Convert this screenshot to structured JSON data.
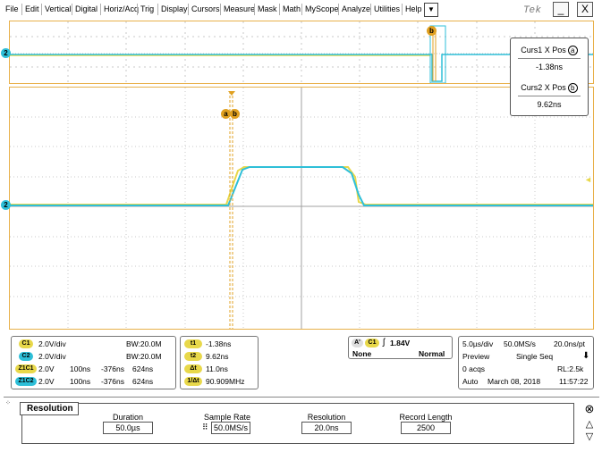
{
  "menu": {
    "items": [
      "File",
      "Edit",
      "Vertical",
      "Digital",
      "Horiz/Acq",
      "Trig",
      "Display",
      "Cursors",
      "Measure",
      "Mask",
      "Math",
      "MyScope",
      "Analyze",
      "Utilities",
      "Help"
    ],
    "dropdown_glyph": "▼",
    "brand": "Tek",
    "minimize_glyph": "_",
    "close_glyph": "X"
  },
  "scope": {
    "ch2_marker": "2",
    "cursor_a_letter": "a",
    "cursor_b_letter": "b",
    "trigger_level_marker": "◄",
    "colors": {
      "ch1": "#e8d84a",
      "ch2": "#2ebfd8",
      "cursor": "#e0a020",
      "grid": "#c0c0c0"
    }
  },
  "cursor_readout": {
    "curs1_label": "Curs1 X Pos",
    "curs1_letter": "a",
    "curs1_value": "-1.38ns",
    "curs2_label": "Curs2 X Pos",
    "curs2_letter": "b",
    "curs2_value": "9.62ns"
  },
  "channels": {
    "c1": {
      "badge": "C1",
      "scale": "2.0V/div",
      "bw": "BW:20.0M"
    },
    "c2": {
      "badge": "C2",
      "scale": "2.0V/div",
      "bw": "BW:20.0M"
    },
    "z1c1": {
      "badge": "Z1C1",
      "scale": "2.0V",
      "time": "100ns",
      "pos": "-376ns",
      "pts": "624ns"
    },
    "z1c2": {
      "badge": "Z1C2",
      "scale": "2.0V",
      "time": "100ns",
      "pos": "-376ns",
      "pts": "624ns"
    }
  },
  "cursor_meas": {
    "t1_badge": "t1",
    "t1": "-1.38ns",
    "t2_badge": "t2",
    "t2": "9.62ns",
    "dt_badge": "Δt",
    "dt": "11.0ns",
    "inv_badge": "1/Δt",
    "inv": "90.909MHz"
  },
  "trigger": {
    "mode_badge": "A'",
    "source_badge": "C1",
    "edge_glyph": "ʃ",
    "level": "1.84V",
    "coupling": "None",
    "type": "Normal"
  },
  "acquisition": {
    "timebase": "5.0µs/div",
    "sample_rate": "50.0MS/s",
    "resolution": "20.0ns/pt",
    "mode": "Preview",
    "seq": "Single Seq",
    "arrow": "⬇",
    "acqs": "0 acqs",
    "record_length": "RL:2.5k",
    "trig_mode": "Auto",
    "date": "March 08, 2018",
    "time": "11:57:22"
  },
  "resolution_panel": {
    "tab": "Resolution",
    "duration_label": "Duration",
    "duration": "50.0µs",
    "sample_rate_label": "Sample Rate",
    "sample_rate": "50.0MS/s",
    "resolution_label": "Resolution",
    "resolution": "20.0ns",
    "record_length_label": "Record Length",
    "record_length": "2500",
    "close_glyph": "⊗",
    "up_glyph": "△",
    "down_glyph": "▽"
  }
}
